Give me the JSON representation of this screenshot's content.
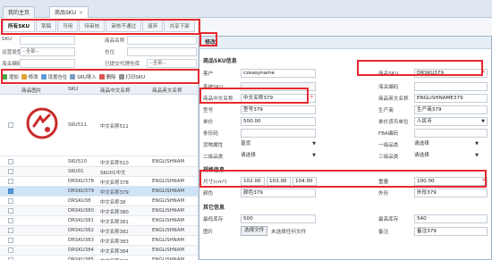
{
  "page_tabs": {
    "home": "我的主页",
    "sku": "商品SKU",
    "close": "×"
  },
  "status_tabs": [
    "所有SKU",
    "草稿",
    "可用",
    "待审核",
    "审核不通过",
    "废弃",
    "共享下架"
  ],
  "filters": {
    "sku_label": "SKU",
    "product_name_label": "商品名称",
    "type_label": "运营类型",
    "type_value": "--全部--",
    "location_label": "仓位",
    "customs_label": "海关编码",
    "oversea_label": "已提交代理仓库",
    "oversea_value": "--全部--"
  },
  "toolbar": [
    "增加",
    "修改",
    "设置仓位",
    "SKU导入",
    "删除",
    "打印SKU"
  ],
  "table": {
    "headers": [
      "商品图片",
      "SKU",
      "商品中文名称",
      "商品英文名称"
    ],
    "first_row": {
      "sku": "SKU511",
      "cn": "中文名称511"
    },
    "rows": [
      {
        "sku": "SKU510",
        "cn": "中文名称510",
        "en": "ENGLISHNAM"
      },
      {
        "sku": "SKU01",
        "cn": "SKU01中文",
        "en": ""
      },
      {
        "sku": "DRSKU378",
        "cn": "中文名称378",
        "en": "ENGLISHNAM"
      },
      {
        "sku": "DRSKU379",
        "cn": "中文名称379",
        "en": "ENGLISHNAM"
      },
      {
        "sku": "DRSKU38",
        "cn": "中文名称38",
        "en": "ENGLISHNAM"
      },
      {
        "sku": "DRSKU380",
        "cn": "中文名称380",
        "en": "ENGLISHNAM"
      },
      {
        "sku": "DRSKU381",
        "cn": "中文名称381",
        "en": "ENGLISHNAM"
      },
      {
        "sku": "DRSKU382",
        "cn": "中文名称382",
        "en": "ENGLISHNAM"
      },
      {
        "sku": "DRSKU383",
        "cn": "中文名称383",
        "en": "ENGLISHNAM"
      },
      {
        "sku": "DRSKU384",
        "cn": "中文名称384",
        "en": "ENGLISHNAM"
      },
      {
        "sku": "DRSKU385",
        "cn": "中文名称385",
        "en": "ENGLISHNAM"
      }
    ]
  },
  "modal": {
    "title": "修改",
    "section_info": "商品SKU信息",
    "customer_label": "客户",
    "customer_value": "czeasyname",
    "sku_label": "商品SKU",
    "sku_value": "DRSKU379",
    "system_sku_label": "系统SKU",
    "customs_code_label": "海关编码",
    "cn_name_label": "商品中文名称",
    "cn_name_value": "中文名称379",
    "en_name_label": "商品英文名称",
    "en_name_value": "ENGLISHNAME379",
    "model_label": "型号",
    "model_value": "型号379",
    "origin_label": "生产商",
    "origin_value": "生产商379",
    "price_label": "单价",
    "price_value": "500.00",
    "currency_label": "单价货币单位",
    "currency_value": "人民币",
    "barcode_label": "条形码",
    "fba_label": "FBA编码",
    "attr_label": "货物属性",
    "attr_value": "普货",
    "cat1_label": "一级品类",
    "cat1_value": "请选择",
    "cat2_label": "二级品类",
    "cat2_value": "请选择",
    "cat3_label": "三级品类",
    "cat3_value": "请选择",
    "section_spec": "规格信息",
    "size_label": "尺寸(cm³)",
    "size_l": "102.00",
    "size_w": "103.00",
    "size_h": "104.00",
    "weight_label": "重量",
    "weight_value": "100.00",
    "color_label": "颜色",
    "color_value": "颜色379",
    "shape_label": "外形",
    "shape_value": "外形379",
    "section_other": "其它信息",
    "min_stock_label": "最低库存",
    "min_stock_value": "500",
    "max_stock_label": "最高库存",
    "max_stock_value": "540",
    "image_label": "图片",
    "file_button": "选择文件",
    "file_none": "未选择任何文件",
    "remark_label": "备注",
    "remark_value": "备注379"
  },
  "colors": {
    "highlight": "#e8282f",
    "selected_row": "#cfe3f7",
    "accent": "#5b9bd5"
  }
}
